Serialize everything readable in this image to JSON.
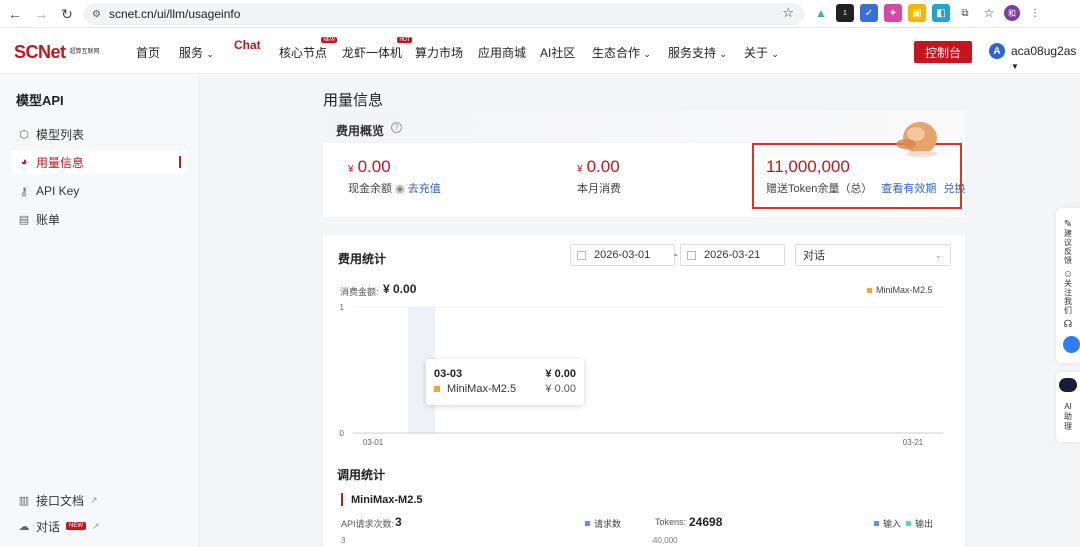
{
  "browser": {
    "url": "scnet.cn/ui/llm/usageinfo"
  },
  "header": {
    "logo": "SCNet",
    "logo_sub": "超算互联网",
    "nav": [
      "首页",
      "服务",
      "Chat",
      "核心节点",
      "龙虾一体机",
      "算力市场",
      "应用商城",
      "AI社区",
      "生态合作",
      "服务支持",
      "关于"
    ],
    "nav_badge_new": "NEW",
    "nav_badge_hot": "HOT",
    "console": "控制台",
    "user_initial": "A",
    "user_name": "aca08ug2as"
  },
  "sidebar": {
    "title": "模型API",
    "items": [
      {
        "label": "模型列表",
        "icon": "cube-icon"
      },
      {
        "label": "用量信息",
        "icon": "pie-chart-icon"
      },
      {
        "label": "API Key",
        "icon": "key-icon"
      },
      {
        "label": "账单",
        "icon": "document-icon"
      }
    ],
    "bottom": [
      {
        "label": "接口文档",
        "icon": "book-icon"
      },
      {
        "label": "对话",
        "icon": "chat-icon",
        "badge": "NEW"
      }
    ]
  },
  "page": {
    "title": "用量信息"
  },
  "overview": {
    "title": "费用概览",
    "cash_balance": "0.00",
    "cash_label": "现金余额",
    "recharge_link": "去充值",
    "month_spend": "0.00",
    "month_label": "本月消费",
    "currency": "¥",
    "token_balance": "11,000,000",
    "token_label": "赠送Token余量（总）",
    "validity_link": "查看有效期",
    "redeem_link": "兑换"
  },
  "stats": {
    "title": "费用统计",
    "start_date": "2026-03-01",
    "end_date": "2026-03-21",
    "dash": "-",
    "select_value": "对话",
    "amount_label": "消费金额:",
    "amount_value": "¥ 0.00",
    "legend": "MiniMax-M2.5",
    "tooltip": {
      "date": "03-03",
      "total": "¥ 0.00",
      "name": "MiniMax-M2.5",
      "value": "¥ 0.00"
    }
  },
  "chart_data": {
    "type": "bar",
    "x_start": "03-01",
    "x_end": "03-21",
    "series": [
      {
        "name": "MiniMax-M2.5",
        "values": [
          0
        ]
      }
    ],
    "ylim": [
      0,
      1
    ],
    "yticks": [
      "0",
      "1"
    ],
    "color": "#f5a623"
  },
  "calls": {
    "title": "调用统计",
    "model": "MiniMax-M2.5",
    "req_label": "API请求次数:",
    "req_value": "3",
    "req_legend": "请求数",
    "req_axis_top": "3",
    "tok_label": "Tokens:",
    "tok_value": "24698",
    "tok_legend_in": "输入",
    "tok_legend_out": "输出",
    "tok_axis_top": "40,000"
  },
  "float": {
    "feedback": "建议反馈",
    "follow": "关注我们",
    "ai": "AI助理"
  }
}
